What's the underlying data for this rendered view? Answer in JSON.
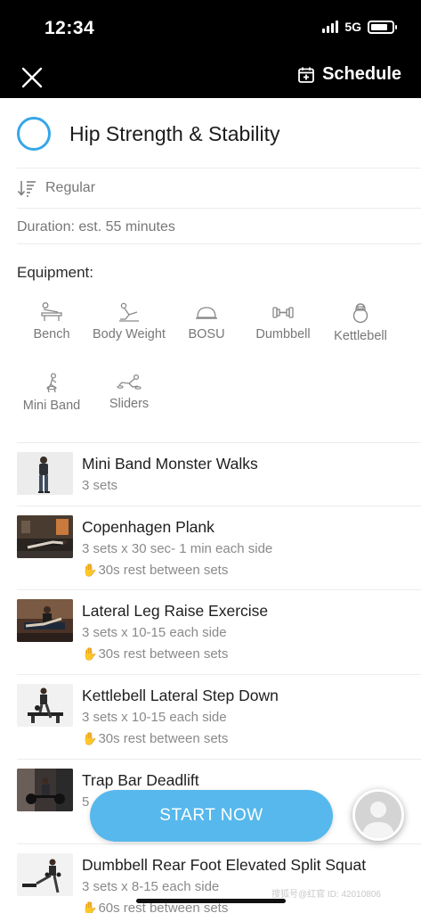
{
  "status_bar": {
    "time": "12:34",
    "network": "5G"
  },
  "nav": {
    "schedule_label": "Schedule",
    "close_icon": "close-icon",
    "calendar_icon": "calendar-plus-icon"
  },
  "workout": {
    "title": "Hip Strength & Stability",
    "type": "Regular",
    "duration": "Duration: est. 55 minutes",
    "equipment_label": "Equipment:",
    "equipment": [
      {
        "label": "Bench",
        "icon": "bench-icon"
      },
      {
        "label": "Body Weight",
        "icon": "body-weight-icon"
      },
      {
        "label": "BOSU",
        "icon": "bosu-icon"
      },
      {
        "label": "Dumbbell",
        "icon": "dumbbell-icon"
      },
      {
        "label": "Kettlebell",
        "icon": "kettlebell-icon"
      },
      {
        "label": "Mini Band",
        "icon": "mini-band-icon"
      },
      {
        "label": "Sliders",
        "icon": "sliders-icon"
      }
    ]
  },
  "exercises": [
    {
      "name": "Mini Band Monster Walks",
      "sets": "3 sets",
      "rest": ""
    },
    {
      "name": "Copenhagen Plank",
      "sets": "3 sets x 30 sec- 1 min each side",
      "rest": "30s rest between sets"
    },
    {
      "name": "Lateral Leg Raise Exercise",
      "sets": "3 sets x 10-15 each side",
      "rest": "30s rest between sets"
    },
    {
      "name": "Kettlebell Lateral Step Down",
      "sets": "3 sets x 10-15 each side",
      "rest": "30s rest between sets"
    },
    {
      "name": "Trap Bar Deadlift",
      "sets": "5",
      "rest": ""
    },
    {
      "name": "Dumbbell Rear Foot Elevated Split Squat",
      "sets": "3 sets x 8-15 each side",
      "rest": "60s rest between sets"
    }
  ],
  "start_label": "START NOW",
  "watermark": "搜狐号@红官 ID: 42010806",
  "colors": {
    "accent": "#35a6e8",
    "button": "#56b8ec",
    "rest_hand": "#f0b22a"
  }
}
